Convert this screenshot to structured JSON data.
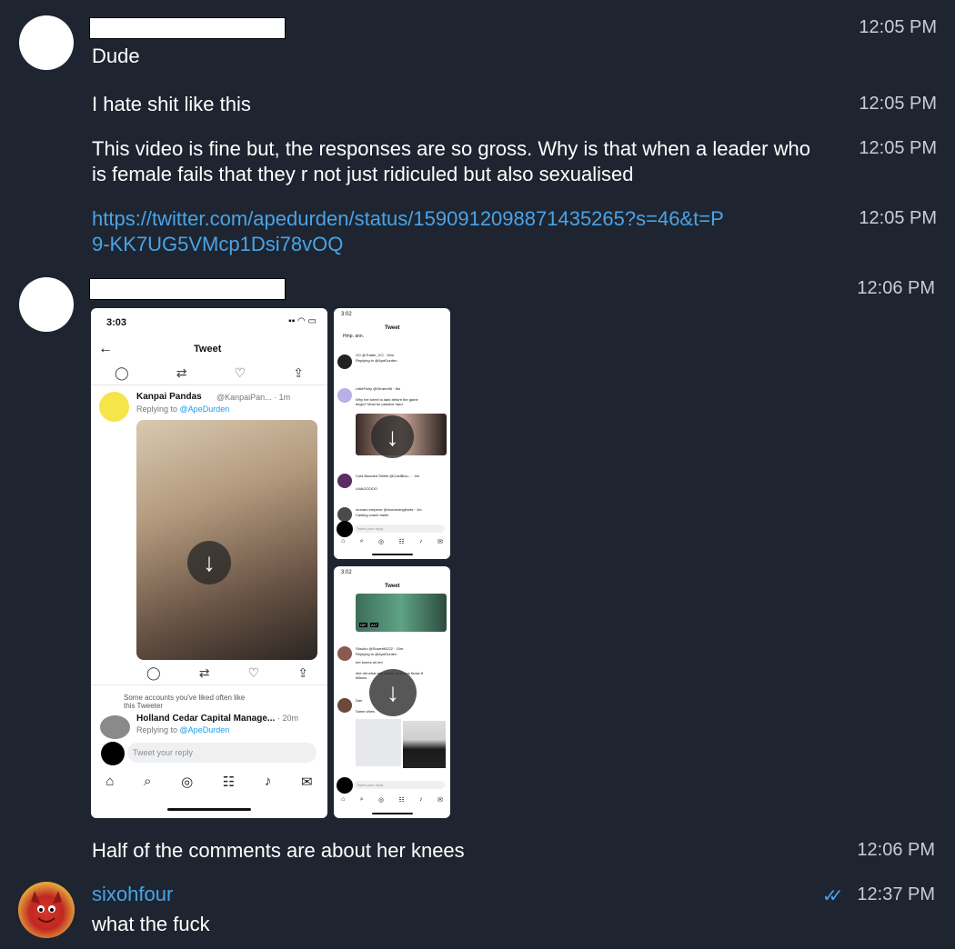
{
  "messages": [
    {
      "text": "Dude",
      "time": "12:05 PM"
    },
    {
      "text": "I hate shit like this",
      "time": "12:05 PM"
    },
    {
      "text": "This video is fine but, the responses are so gross. Why is that when a leader who is female fails that they r not just ridiculed but also sexualised",
      "time": "12:05 PM"
    },
    {
      "text": "https://twitter.com/apedurden/status/1590912098871435265?s=46&t=P9-KK7UG5VMcp1Dsi78vOQ",
      "time": "12:05 PM"
    },
    {
      "time": "12:06 PM"
    },
    {
      "text": "Half of the comments are about her knees",
      "time": "12:06 PM"
    },
    {
      "sender": "sixohfour",
      "text": "what the fuck",
      "time": "12:37 PM",
      "status": "read-double-check-icon"
    }
  ],
  "shot_main": {
    "clock": "3:03",
    "header": "Tweet",
    "author": "Kanpai Pandas",
    "handle": "@KanpaiPan... · 1m",
    "replying": "Replying to",
    "mention": "@ApeDurden",
    "liked_note_1": "Some accounts you've liked often like",
    "liked_note_2": "this Tweeter",
    "author2": "Holland Cedar Capital Manage...",
    "time2": "· 20m",
    "reply_placeholder": "Tweet your reply"
  },
  "shot_a": {
    "clock": "3:02",
    "header": "Tweet",
    "line1": "Hmp. ann.",
    "user1": "XO @Trader_XO · 16m",
    "user2": "LittleFishy @Gfrarm96 · 8m",
    "text2a": "Why her kneel is dark before the game",
    "text2b": "begin? Must be practice hard",
    "user3": "Cold Blooded Shiller @ColdBloo... · 4m",
    "text3": "LMAOOOOO",
    "user4": "monaro emperor @monaroinglbrnts · 1m",
    "text4": "Casting coach trailer",
    "replying": "Replying to @ApeDurden",
    "reply_placeholder": "Tweet your reply"
  },
  "shot_b": {
    "clock": "3:02",
    "header": "Tweet",
    "gif": "GIF",
    "alt": "ALT",
    "user1": "Sdsuho @Suwerit0222 · 10m",
    "replying": "Replying to @ApeDurden",
    "text1": "her knees all red",
    "text2a": "she did what she had to do to cop those 8",
    "text2b": "billions .",
    "user2": "Dan",
    "text3": "Same vibes",
    "reply_placeholder": "Tweet your reply"
  },
  "colors": {
    "background": "#1e2530",
    "link": "#4aa3e6",
    "time": "#c7cdd6",
    "twitter_blue": "#1d9bf0"
  }
}
